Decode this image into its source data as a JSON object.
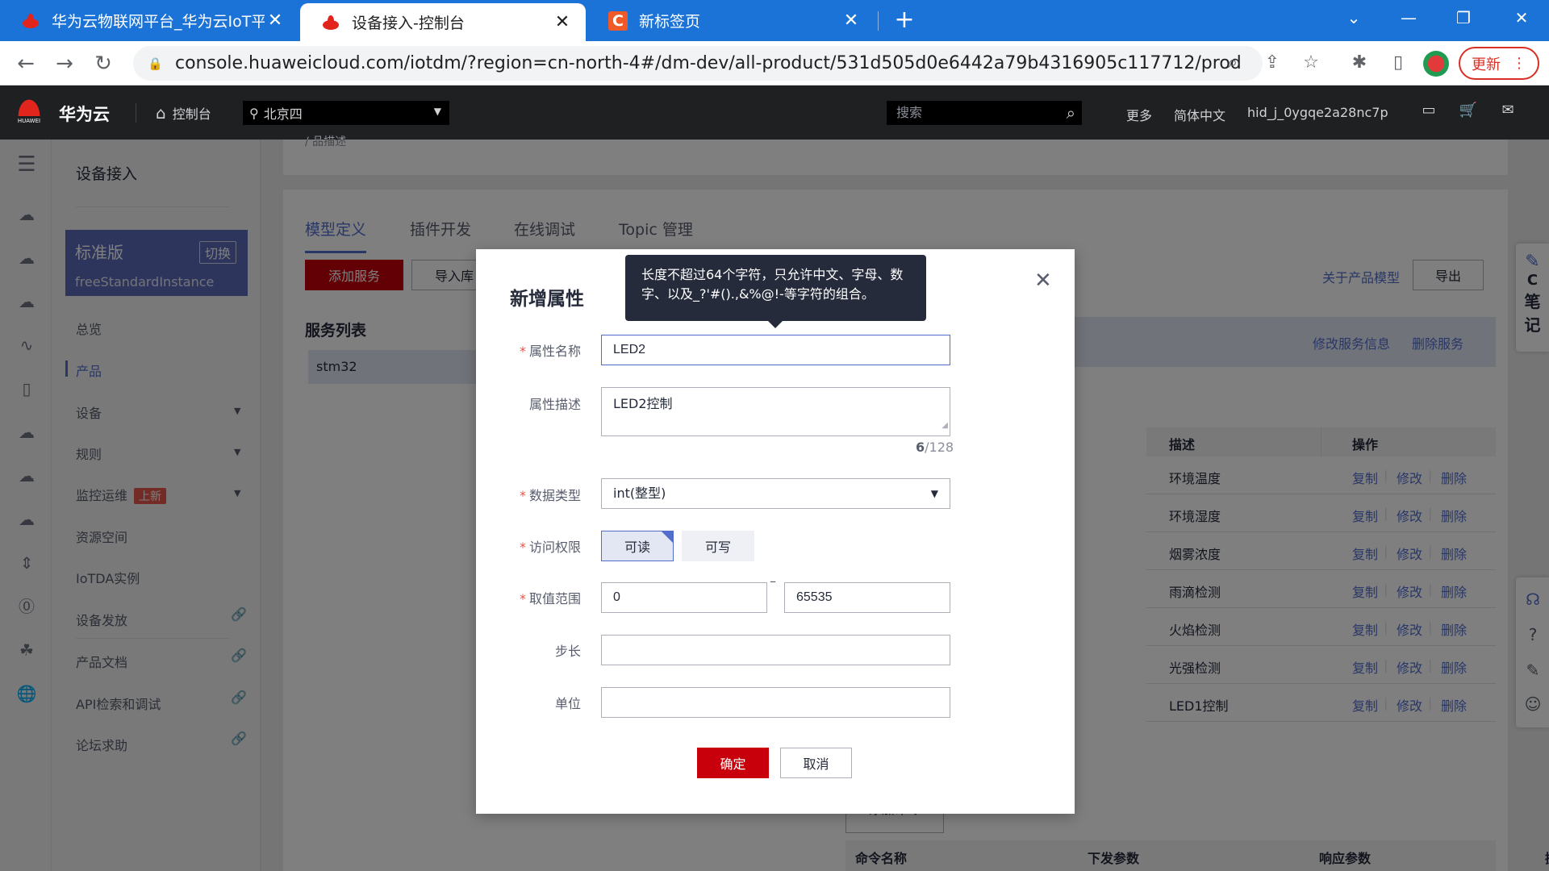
{
  "browser": {
    "tabs": [
      {
        "title": "华为云物联网平台_华为云IoT平台",
        "close": "✕"
      },
      {
        "title": "设备接入-控制台",
        "close": "✕"
      },
      {
        "title": "新标签页",
        "close": "✕"
      }
    ],
    "new_tab": "+",
    "url": "console.huaweicloud.com/iotdm/?region=cn-north-4#/dm-dev/all-product/531d505d0e6442a79b4316905c117712/product-...",
    "update_label": "更新"
  },
  "console_header": {
    "logo_text": "HUAWEI",
    "brand": "华为云",
    "console_label": "控制台",
    "region": "北京四",
    "search_placeholder": "搜索",
    "more": "更多",
    "language": "简体中文",
    "user": "hid_j_0ygqe2a28nc7p"
  },
  "sidemenu": {
    "title": "设备接入",
    "edition": {
      "name": "标准版",
      "switch": "切换",
      "instance": "freeStandardInstance"
    },
    "items": [
      {
        "label": "总览"
      },
      {
        "label": "产品"
      },
      {
        "label": "设备"
      },
      {
        "label": "规则"
      },
      {
        "label": "监控运维",
        "badge": "上新"
      },
      {
        "label": "资源空间"
      },
      {
        "label": "IoTDA实例"
      },
      {
        "label": "设备发放"
      },
      {
        "label": "产品文档"
      },
      {
        "label": "API检索和调试"
      },
      {
        "label": "论坛求助"
      }
    ]
  },
  "main": {
    "breadcrumb_fragment": "/ 品描述",
    "tabs": [
      {
        "label": "模型定义"
      },
      {
        "label": "插件开发"
      },
      {
        "label": "在线调试"
      },
      {
        "label": "Topic 管理"
      }
    ],
    "add_service": "添加服务",
    "import": "导入库",
    "about_model": "关于产品模型",
    "export": "导出",
    "service_list_title": "服务列表",
    "service_item": "stm32",
    "edit_service": "修改服务信息",
    "delete_service": "删除服务",
    "table_headers": {
      "desc": "描述",
      "ops": "操作"
    },
    "rows": [
      {
        "desc": "环境温度"
      },
      {
        "desc": "环境湿度"
      },
      {
        "desc": "烟雾浓度"
      },
      {
        "desc": "雨滴检测"
      },
      {
        "desc": "火焰检测"
      },
      {
        "desc": "光强检测"
      },
      {
        "desc": "LED1控制"
      }
    ],
    "ops": {
      "copy": "复制",
      "edit": "修改",
      "delete": "删除"
    },
    "add_command": "添加命令",
    "cmd_headers": {
      "name": "命令名称",
      "params": "下发参数",
      "resp": "响应参数",
      "ops": "操作"
    }
  },
  "float_note": {
    "label_c": "C",
    "label1": "笔",
    "label2": "记"
  },
  "dialog": {
    "title": "新增属性",
    "tooltip": "长度不超过64个字符，只允许中文、字母、数字、以及_?'#().,&%@!-等字符的组合。",
    "required_mark": "*",
    "labels": {
      "name": "属性名称",
      "desc": "属性描述",
      "type": "数据类型",
      "access": "访问权限",
      "range": "取值范围",
      "step": "步长",
      "unit": "单位"
    },
    "values": {
      "name": "LED2",
      "desc": "LED2控制",
      "type": "int(整型)",
      "range_min": "0",
      "range_max": "65535",
      "step": "",
      "unit": ""
    },
    "desc_count": "6",
    "desc_max": "/128",
    "access_options": [
      {
        "label": "可读",
        "selected": true
      },
      {
        "label": "可写",
        "selected": false
      }
    ],
    "range_dash": "–",
    "ok": "确定",
    "cancel": "取消"
  }
}
